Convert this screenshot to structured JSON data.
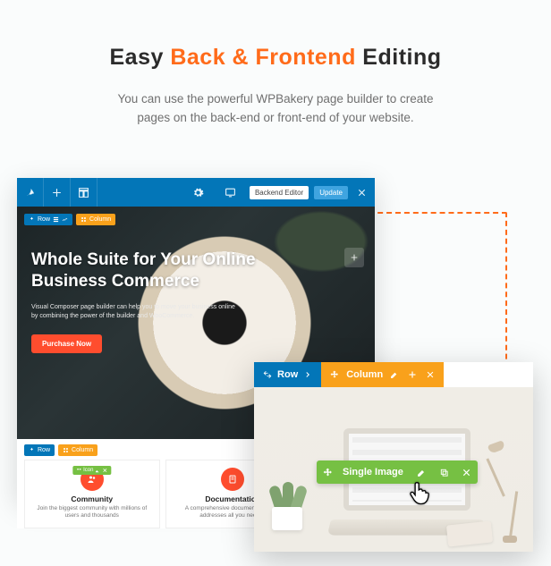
{
  "heading": {
    "pre": "Easy ",
    "accent": "Back & Frontend",
    "post": " Editing"
  },
  "subtitle_l1": "You can use the powerful WPBakery page builder to create",
  "subtitle_l2": "pages on the back-end or front-end of your website.",
  "builder": {
    "topbar": {
      "backend_btn": "Backend Editor",
      "update_btn": "Update"
    },
    "hero": {
      "row_label": "Row",
      "col_label": "Column",
      "title": "Whole Suite for Your Online Business Commerce",
      "desc": "Visual Composer page builder can help you to move your business online by combining the power of the builder and WooCommerce.",
      "cta": "Purchase Now"
    },
    "cards_toolbar": {
      "row": "Row",
      "col": "Column"
    },
    "cards": [
      {
        "green_label": "Icon",
        "title": "Community",
        "desc": "Join the biggest community with millions of users and thousands"
      },
      {
        "title": "Documentation",
        "desc": "A comprehensive documentation that addresses all you need to"
      },
      {
        "title": "",
        "desc": ""
      }
    ]
  },
  "panel2": {
    "row": "Row",
    "col": "Column",
    "single_image": "Single Image"
  }
}
